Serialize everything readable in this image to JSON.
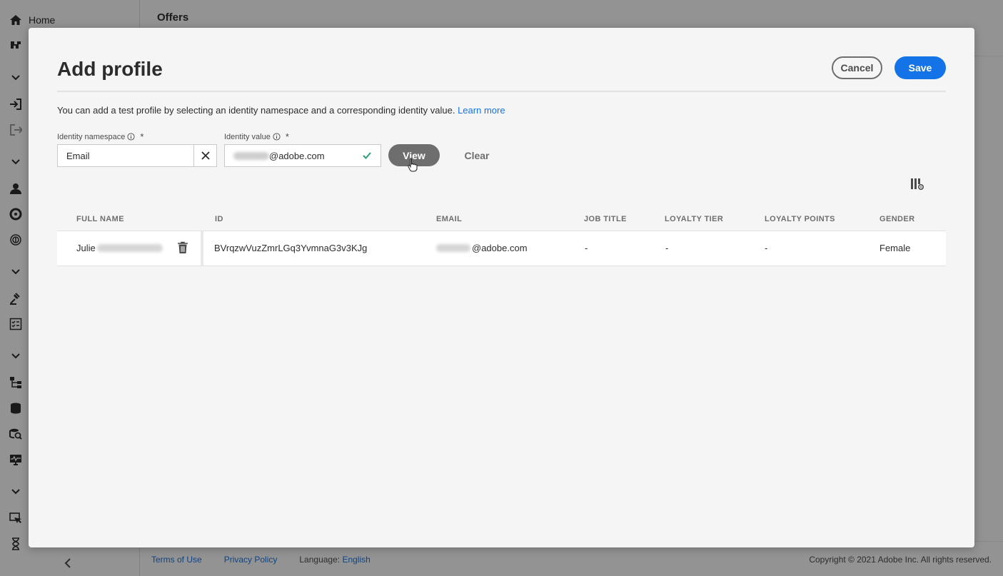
{
  "sidebar": {
    "home_label": "Home",
    "icons": [
      "home-icon",
      "journey-icon",
      "chevron-down-icon",
      "import-icon",
      "export-icon",
      "chevron-down-icon",
      "profile-icon",
      "segment-icon",
      "fingerprint-icon",
      "chevron-down-icon",
      "decisioning-icon",
      "checklist-icon",
      "chevron-down-icon",
      "schema-icon",
      "dataset-icon",
      "query-icon",
      "monitoring-icon",
      "chevron-down-icon",
      "offers-icon",
      "hourglass-icon"
    ],
    "collapse_icon": "chevron-left-icon"
  },
  "header": {
    "title": "Offers"
  },
  "footer": {
    "terms": "Terms of Use",
    "privacy": "Privacy Policy",
    "language_label": "Language:",
    "language_value": "English",
    "copyright": "Copyright © 2021 Adobe Inc. All rights reserved."
  },
  "modal": {
    "title": "Add profile",
    "cancel_label": "Cancel",
    "save_label": "Save",
    "intro_text": "You can add a test profile by selecting an identity namespace and a corresponding identity value.",
    "learn_more": "Learn more",
    "namespace": {
      "label": "Identity namespace",
      "required_mark": "*",
      "value": "Email"
    },
    "identity_value": {
      "label": "Identity value",
      "required_mark": "*",
      "value": "@adobe.com"
    },
    "view_label": "View",
    "clear_label": "Clear"
  },
  "table": {
    "columns": [
      "FULL NAME",
      "ID",
      "EMAIL",
      "JOB TITLE",
      "LOYALTY TIER",
      "LOYALTY POINTS",
      "GENDER"
    ],
    "rows": [
      {
        "full_name": "Julie",
        "id": "BVrqzwVuzZmrLGq3YvmnaG3v3KJg",
        "email": "@adobe.com",
        "job_title": "-",
        "loyalty_tier": "-",
        "loyalty_points": "-",
        "gender": "Female"
      }
    ]
  },
  "colors": {
    "accent": "#1473e6",
    "valid": "#2d9d78",
    "secondary_button": "#6e6e6e"
  }
}
